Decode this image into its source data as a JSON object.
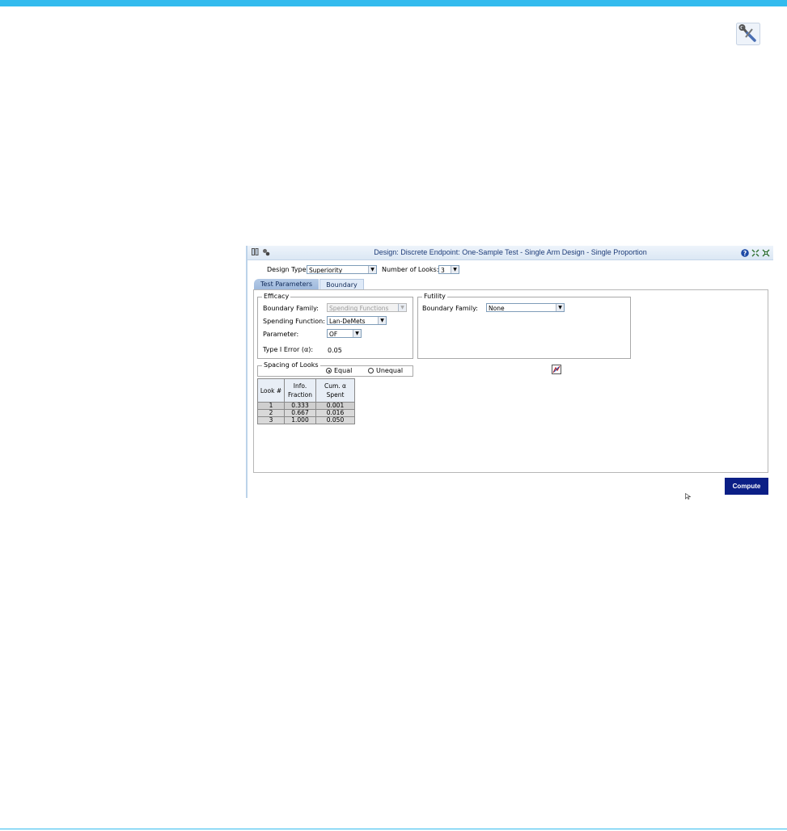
{
  "window": {
    "title": "Design: Discrete Endpoint: One-Sample Test - Single Arm Design - Single Proportion"
  },
  "design": {
    "design_type_label": "Design Type:",
    "design_type_value": "Superiority",
    "looks_label": "Number of Looks:",
    "looks_value": "3"
  },
  "tabs": [
    {
      "label": "Test Parameters"
    },
    {
      "label": "Boundary"
    }
  ],
  "efficacy": {
    "legend": "Efficacy",
    "boundary_family_label": "Boundary Family:",
    "boundary_family_value": "Spending Functions",
    "spending_function_label": "Spending Function:",
    "spending_function_value": "Lan-DeMets",
    "parameter_label": "Parameter:",
    "parameter_value": "OF",
    "type1_label": "Type I Error (α):",
    "type1_value": "0.05"
  },
  "futility": {
    "legend": "Futility",
    "boundary_family_label": "Boundary Family:",
    "boundary_family_value": "None"
  },
  "spacing": {
    "legend": "Spacing of Looks",
    "equal_label": "Equal",
    "unequal_label": "Unequal",
    "selected": "Equal"
  },
  "looks_table": {
    "headers": [
      "Look #",
      "Info. Fraction",
      "Cum. α Spent"
    ],
    "header_lines": [
      [
        "Look #"
      ],
      [
        "Info.",
        "Fraction"
      ],
      [
        "Cum. α",
        "Spent"
      ]
    ],
    "rows": [
      [
        "1",
        "0.333",
        "0.001"
      ],
      [
        "2",
        "0.667",
        "0.016"
      ],
      [
        "3",
        "1.000",
        "0.050"
      ]
    ]
  },
  "compute_label": "Compute",
  "colors": {
    "accent_bar": "#33bbee",
    "compute_button": "#0b1f86",
    "title_text": "#1c3b78"
  },
  "icons": [
    "tools-icon",
    "help-icon",
    "collapse-icon",
    "expand-icon",
    "chart-edit-icon",
    "window-pin-icon",
    "gears-icon"
  ]
}
